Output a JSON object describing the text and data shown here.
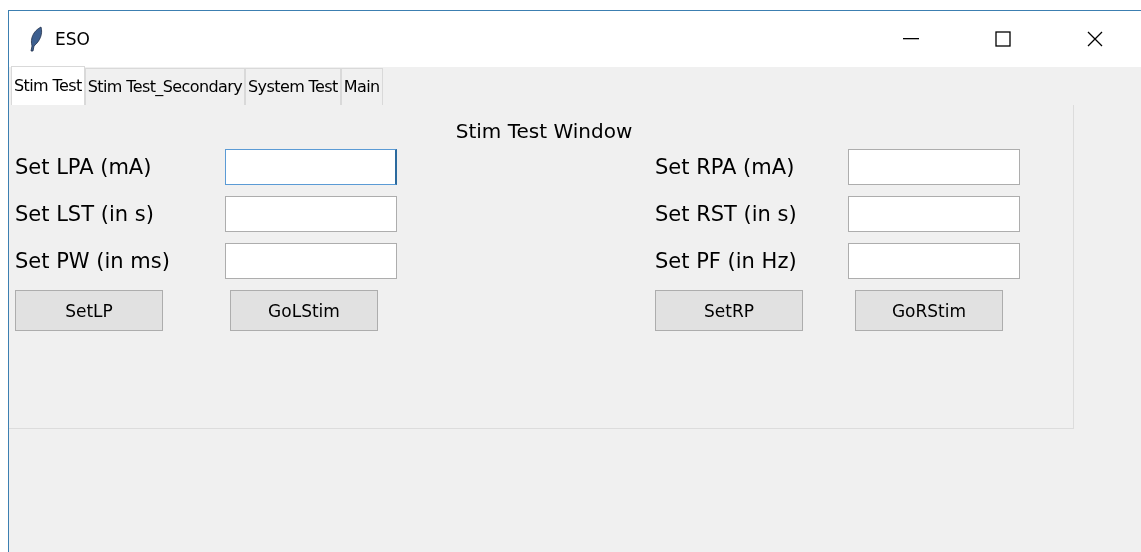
{
  "window": {
    "title": "ESO"
  },
  "tabs": [
    {
      "label": "Stim Test",
      "selected": true
    },
    {
      "label": "Stim Test_Secondary",
      "selected": false
    },
    {
      "label": "System Test",
      "selected": false
    },
    {
      "label": "Main",
      "selected": false
    }
  ],
  "panel": {
    "heading": "Stim Test Window",
    "left": {
      "fields": [
        {
          "label": "Set LPA (mA)",
          "focused": true
        },
        {
          "label": "Set LST (in s)",
          "focused": false
        },
        {
          "label": "Set PW (in ms)",
          "focused": false
        }
      ],
      "buttons": [
        "SetLP",
        "GoLStim"
      ]
    },
    "right": {
      "fields": [
        {
          "label": "Set RPA (mA)",
          "focused": false
        },
        {
          "label": "Set RST (in s)",
          "focused": false
        },
        {
          "label": "Set PF (in Hz)",
          "focused": false
        }
      ],
      "buttons": [
        "SetRP",
        "GoRStim"
      ]
    }
  }
}
